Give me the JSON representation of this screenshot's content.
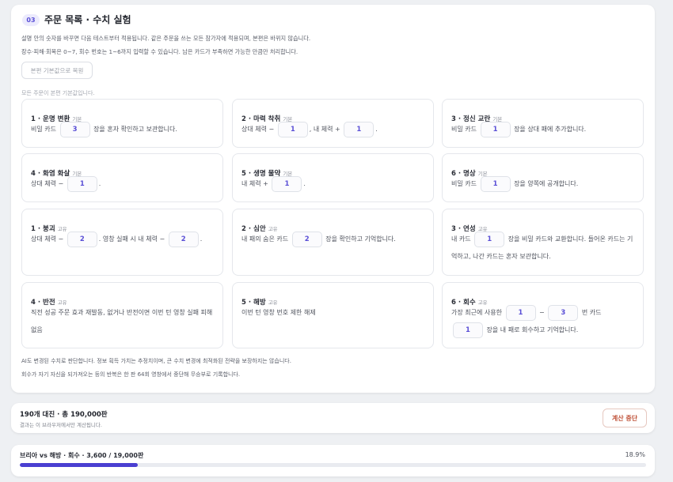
{
  "section": {
    "step": "03",
    "title": "주문 목록 · 수치 실험",
    "desc1": "설명 안의 숫자를 바꾸면 다음 테스트부터 적용됩니다. 같은 주문을 쓰는 모든 참가자에 적용되며, 본편은 바뀌지 않습니다.",
    "desc2": "장수·피해·회복은 0~7, 회수 번호는 1~6까지 입력할 수 있습니다. 남은 카드가 부족하면 가능한 만큼만 처리합니다.",
    "reset_label": "본편 기본값으로 복원",
    "defaults_note": "모든 주문이 본편 기본값입니다.",
    "foot1": "AI도 변경된 수치로 판단합니다. 정보 획득 가치는 추정치이며, 큰 수치 변경에 최적화된 전략을 보장하지는 않습니다.",
    "foot2": "회수가 자기 자신을 되가져오는 등의 반복은 한 판 64회 영창에서 중단해 무승부로 기록합니다."
  },
  "cards": [
    {
      "name": "1 · 운명 변환",
      "tag": "기본",
      "parts": [
        "비밀 카드 ",
        {
          "v": "3"
        },
        " 장을 혼자 확인하고 보관합니다."
      ]
    },
    {
      "name": "2 · 마력 착취",
      "tag": "기본",
      "parts": [
        "상대 체력 − ",
        {
          "v": "1"
        },
        ", 내 체력 + ",
        {
          "v": "1"
        },
        "."
      ]
    },
    {
      "name": "3 · 정신 교란",
      "tag": "기본",
      "parts": [
        "비밀 카드 ",
        {
          "v": "1"
        },
        " 장을 상대 패에 추가합니다."
      ]
    },
    {
      "name": "4 · 화염 화살",
      "tag": "기본",
      "parts": [
        "상대 체력 − ",
        {
          "v": "1"
        },
        "."
      ]
    },
    {
      "name": "5 · 생명 물약",
      "tag": "기본",
      "parts": [
        "내 체력 + ",
        {
          "v": "1"
        },
        "."
      ]
    },
    {
      "name": "6 · 명상",
      "tag": "기본",
      "parts": [
        "비밀 카드 ",
        {
          "v": "1"
        },
        " 장을 양쪽에 공개합니다."
      ]
    },
    {
      "name": "1 · 붕괴",
      "tag": "고유",
      "parts": [
        "상대 체력 − ",
        {
          "v": "2"
        },
        ". 영창 실패 시 내 체력 − ",
        {
          "v": "2"
        },
        "."
      ]
    },
    {
      "name": "2 · 심안",
      "tag": "고유",
      "parts": [
        "내 패의 숨은 카드 ",
        {
          "v": "2"
        },
        " 장을 확인하고 기억합니다."
      ]
    },
    {
      "name": "3 · 연성",
      "tag": "고유",
      "parts": [
        "내 카드 ",
        {
          "v": "1"
        },
        " 장을 비밀 카드와 교환합니다. 들어온 카드는 기억하고, 나간 카드는 혼자 보관합니다."
      ]
    },
    {
      "name": "4 · 반전",
      "tag": "고유",
      "parts": [
        "직전 성공 주문 효과 재발동, 없거나 반전이면 이번 턴 영창 실패 피해 없음"
      ]
    },
    {
      "name": "5 · 해방",
      "tag": "고유",
      "parts": [
        "이번 턴 영창 번호 제한 해제"
      ]
    },
    {
      "name": "6 · 회수",
      "tag": "고유",
      "parts": [
        "가장 최근에 사용한 ",
        {
          "v": "1"
        },
        " − ",
        {
          "v": "3"
        },
        " 번 카드 ",
        {
          "v": "1"
        },
        " 장을 내 패로 회수하고 기억합니다."
      ]
    }
  ],
  "summary": {
    "title": "190개 대진 · 총 190,000판",
    "sub": "결과는 이 브라우저에서만 계산됩니다.",
    "stop_label": "계산 중단"
  },
  "progress": {
    "label": "브리아 vs 해방 · 회수 · 3,600 / 19,000판",
    "percent_label": "18.9%",
    "fraction": 0.189
  }
}
